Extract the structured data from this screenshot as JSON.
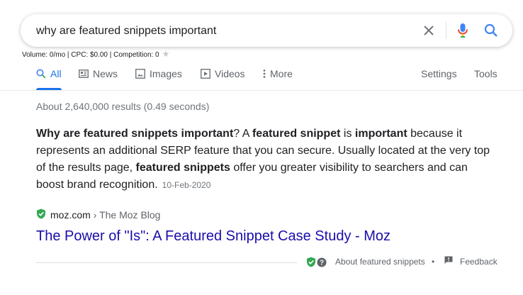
{
  "search": {
    "query": "why are featured snippets important",
    "clear_icon": "close-icon",
    "mic_icon": "mic-icon",
    "search_icon": "search-icon"
  },
  "metrics": {
    "text": "Volume: 0/mo | CPC: $0.00 | Competition: 0",
    "star": "★"
  },
  "tabs": {
    "all": "All",
    "news": "News",
    "images": "Images",
    "videos": "Videos",
    "more": "More",
    "settings": "Settings",
    "tools": "Tools"
  },
  "results": {
    "stats": "About 2,640,000 results (0.49 seconds)",
    "snippet": {
      "parts": [
        {
          "t": "Why are featured snippets important",
          "b": true
        },
        {
          "t": "? A ",
          "b": false
        },
        {
          "t": "featured snippet",
          "b": true
        },
        {
          "t": " is ",
          "b": false
        },
        {
          "t": "important",
          "b": true
        },
        {
          "t": " because it represents an additional SERP feature that you can secure. Usually located at the very top of the results page, ",
          "b": false
        },
        {
          "t": "featured snippets",
          "b": true
        },
        {
          "t": " offer you greater visibility to searchers and can boost brand recognition.",
          "b": false
        }
      ],
      "date": "10-Feb-2020"
    },
    "cite_domain": "moz.com",
    "cite_path": "› The Moz Blog",
    "title": "The Power of \"Is\": A Featured Snippet Case Study - Moz"
  },
  "footer": {
    "about": "About featured snippets",
    "separator": "•",
    "feedback": "Feedback"
  },
  "colors": {
    "accent": "#1a73e8",
    "link": "#1a0dab",
    "verified": "#34a853"
  }
}
